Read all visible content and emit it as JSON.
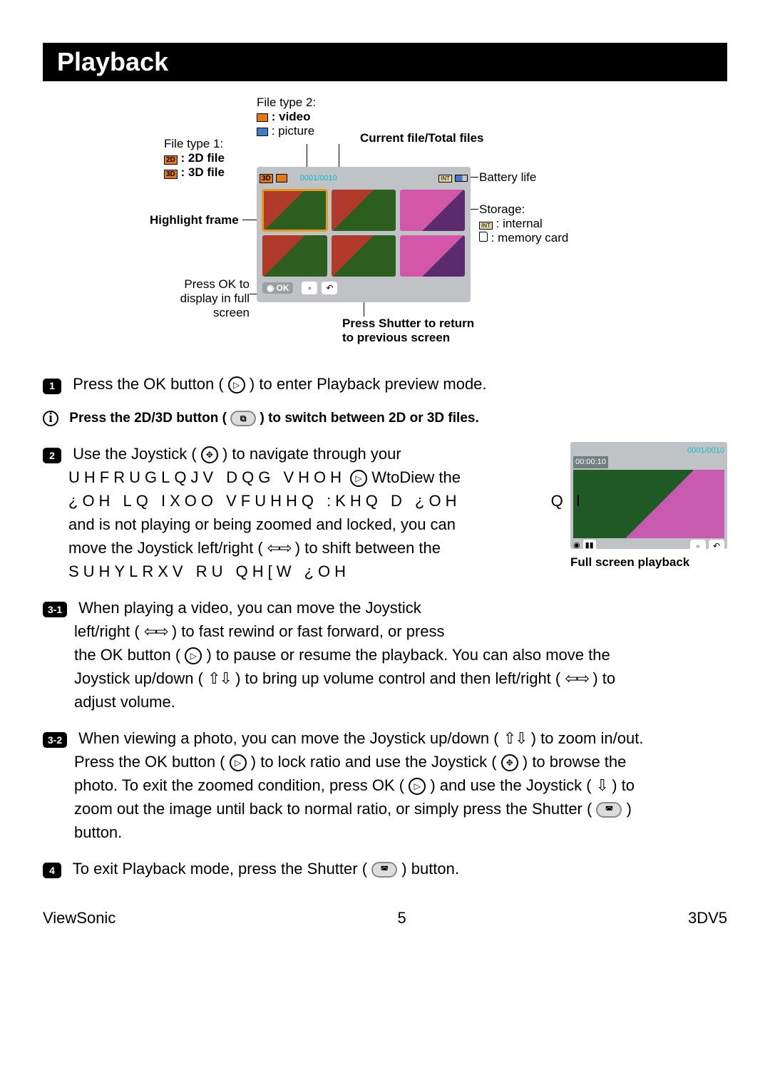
{
  "header": {
    "title": "Playback"
  },
  "diagram": {
    "ft1_label": "File type 1:",
    "ft1_2d": ": 2D file",
    "ft1_3d": ": 3D file",
    "ft2_label": "File type 2:",
    "ft2_video": ": video",
    "ft2_picture": ": picture",
    "cur_total": "Current file/Total files",
    "counter": "0001/0010",
    "battery": "Battery life",
    "storage": "Storage:",
    "storage_int": ": internal",
    "storage_mc": ": memory card",
    "highlight": "Highlight frame",
    "ok_full_1": "Press OK to",
    "ok_full_2": "display in full",
    "ok_full_3": "screen",
    "ok_label": "OK",
    "shutter_ret_1": "Press Shutter to return",
    "shutter_ret_2": "to previous screen"
  },
  "steps": {
    "s1": "Press the OK button (",
    "s1b": ") to enter Playback preview mode.",
    "info": "Press the 2D/3D button (",
    "info_b": ") to switch between 2D or 3D files.",
    "s2a": "Use the Joystick (",
    "s2b": ") to navigate through your",
    "garble1": "UHFRUGLQJV DQG VHOH",
    "garble1mid": "WtoDiew",
    "garble1end": "the",
    "garble2": "¿OH LQ IXOO VFUHHQ :KHQ D ¿OH",
    "garble2end": "Q  I",
    "s2c": "and is not playing or being zoomed and locked, you can",
    "s2d": "move the Joystick left/right (",
    "s2e": ") to shift between the",
    "garble3": "SUHYLRXV RU QH[W ¿OH",
    "fs_caption": "Full screen playback",
    "mini_counter": "0001/0010",
    "mini_time": "00:00:10",
    "s31a": "When playing a video, you can move the Joystick",
    "s31b": "left/right (",
    "s31c": ") to fast rewind or fast forward, or press",
    "s31d": "the OK button (",
    "s31e": ") to pause or resume the playback. You can also move the",
    "s31f": "Joystick up/down (",
    "s31g": ") to bring up volume control and then left/right (",
    "s31h": ") to",
    "s31i": "adjust volume.",
    "s32a": "When viewing a photo, you can move the Joystick up/down (",
    "s32b": ") to zoom in/out.",
    "s32c": "Press the OK button (",
    "s32d": ") to lock ratio and use the Joystick (",
    "s32e": ") to browse the",
    "s32f": "photo. To exit the zoomed condition, press OK (",
    "s32g": ") and use the Joystick (",
    "s32h": ") to",
    "s32i": "zoom out the image until back to normal ratio, or simply press the Shutter (",
    "s32j": ")",
    "s32k": "button.",
    "s4a": "To exit Playback mode, press the Shutter (",
    "s4b": ") button."
  },
  "footer": {
    "brand": "ViewSonic",
    "page": "5",
    "model": "3DV5"
  }
}
